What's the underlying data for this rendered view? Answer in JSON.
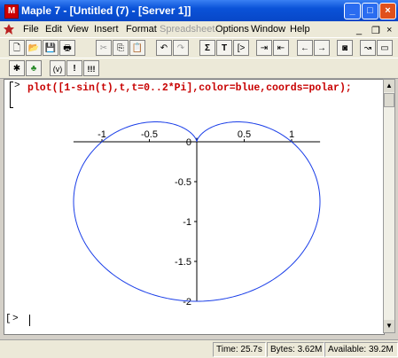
{
  "window": {
    "title": "Maple 7 - [Untitled (7) - [Server 1]]"
  },
  "menu": {
    "items": [
      {
        "label": "File",
        "disabled": false
      },
      {
        "label": "Edit",
        "disabled": false
      },
      {
        "label": "View",
        "disabled": false
      },
      {
        "label": "Insert",
        "disabled": false
      },
      {
        "label": "Format",
        "disabled": false
      },
      {
        "label": "Spreadsheet",
        "disabled": true
      },
      {
        "label": "Options",
        "disabled": false
      },
      {
        "label": "Window",
        "disabled": false
      },
      {
        "label": "Help",
        "disabled": false
      }
    ]
  },
  "toolbar2": {
    "labels": [
      "(v)",
      "!",
      "!!!"
    ]
  },
  "worksheet": {
    "prompt": ">",
    "command": "plot([1-sin(t),t,t=0..2*Pi],color=blue,coords=polar);",
    "next_prompt": ">"
  },
  "chart_data": {
    "type": "line",
    "series": [
      {
        "color": "#1a3ee8",
        "equation_polar": "r = 1 - sin(t)",
        "t_range": [
          0,
          6.2832
        ]
      }
    ],
    "x_ticks": [
      -1,
      -0.5,
      0.5,
      1
    ],
    "y_ticks": [
      0,
      -0.5,
      -1,
      -1.5,
      -2
    ],
    "x_tick_labels": [
      "-1",
      "-0.5",
      "0.5",
      "1"
    ],
    "y_tick_labels": [
      "0",
      "-0.5",
      "-1",
      "-1.5",
      "-2"
    ],
    "xlim": [
      -1.3,
      1.3
    ],
    "ylim": [
      -2.0,
      0.05
    ],
    "grid": false
  },
  "status": {
    "time": "Time: 25.7s",
    "bytes": "Bytes: 3.62M",
    "available": "Available: 39.2M"
  }
}
